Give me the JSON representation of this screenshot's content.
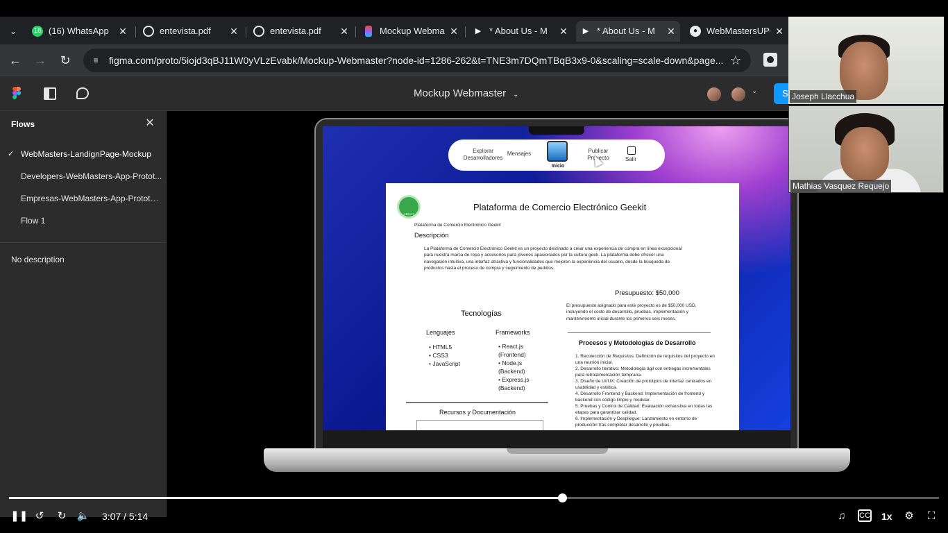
{
  "browser": {
    "tabs": [
      {
        "title": "(16) WhatsApp",
        "icon": "whatsapp-icon",
        "badge": "16"
      },
      {
        "title": "entevista.pdf",
        "icon": "globe-icon"
      },
      {
        "title": "entevista.pdf",
        "icon": "globe-icon"
      },
      {
        "title": "Mockup Webma",
        "icon": "figma-icon"
      },
      {
        "title": "* About Us - M",
        "icon": "play-icon"
      },
      {
        "title": "* About Us - M",
        "icon": "play-icon"
      },
      {
        "title": "WebMastersUPC",
        "icon": "github-icon"
      }
    ],
    "url": "figma.com/proto/5iojd3qBJ11W0yVLzEvabk/Mockup-Webmaster?node-id=1286-262&t=TNE3m7DQmTBqB3x9-0&scaling=scale-down&page..."
  },
  "figma": {
    "file_title": "Mockup Webmaster",
    "share_label": "S",
    "flows_title": "Flows",
    "flows": [
      {
        "label": "WebMasters-LandignPage-Mockup",
        "active": true
      },
      {
        "label": "Developers-WebMasters-App-Protot...",
        "active": false
      },
      {
        "label": "Empresas-WebMasters-App-Prototyp...",
        "active": false
      },
      {
        "label": "Flow 1",
        "active": false
      }
    ],
    "description": "No description"
  },
  "mockup": {
    "nav": {
      "explore": "Explorar Desarrolladores",
      "messages": "Mensajes",
      "home": "Inicio",
      "publish": "Publicar Proyecto",
      "exit": "Salir"
    },
    "doc": {
      "logo_text": "GEEKIT",
      "title": "Plataforma de Comercio Electrónico Geekit",
      "subtitle": "Plataforma de Comercio Electrónico Geekit",
      "description_heading": "Descripción",
      "description_body": "La Plataforma de Comercio Electrónico Geekit es un proyecto destinado a crear una experiencia de compra en línea excepcional para nuestra marca de ropa y accesorios para jóvenes apasionados por la cultura geek. La plataforma debe ofrecer una navegación intuitiva, una interfaz atractiva y funcionalidades que mejoren la experiencia del usuario, desde la búsqueda de productos hasta el proceso de compra y seguimiento de pedidos.",
      "budget_heading": "Presupuesto: $50,000",
      "budget_body": "El presupuesto asignado para este proyecto es de $50,000 USD, incluyendo el costo de desarrollo, pruebas, implementación y mantenimiento inicial durante los primeros seis meses.",
      "tech_heading": "Tecnologías",
      "languages_heading": "Lenguajes",
      "languages": [
        "HTML5",
        "CSS3",
        "JavaScript"
      ],
      "frameworks_heading": "Frameworks",
      "frameworks": [
        "React.js (Frontend)",
        "Node.js (Backend)",
        "Express.js (Backend)"
      ],
      "process_heading": "Procesos y Metodologías de Desarrollo",
      "process_steps": [
        "1. Recolección de Requisitos: Definición de requisitos del proyecto en una reunión inicial.",
        "2. Desarrollo Iterativo: Metodología ágil con entregas incrementales para retroalimentación temprana.",
        "3. Diseño de UI/UX: Creación de prototipos de interfaz centrados en usabilidad y estética.",
        "4. Desarrollo Frontend y Backend: Implementación de frontend y backend con código limpio y modular.",
        "5. Pruebas y Control de Calidad: Evaluación exhaustiva en todas las etapas para garantizar calidad.",
        "6. Implementación y Despliegue: Lanzamiento en entorno de producción tras completar desarrollo y pruebas."
      ],
      "resources_heading": "Recursos y Documentación"
    }
  },
  "participants": [
    {
      "name": "Joseph Llacchua"
    },
    {
      "name": "Mathias Vasquez Requejo"
    }
  ],
  "player": {
    "current_time": "3:07",
    "duration": "5:14",
    "time_display": "3:07 / 5:14",
    "progress": 0.595,
    "speed": "1x"
  },
  "colors": {
    "figma_accent": "#0d99ff",
    "whatsapp": "#25d366",
    "chrome_bg": "#202124"
  }
}
